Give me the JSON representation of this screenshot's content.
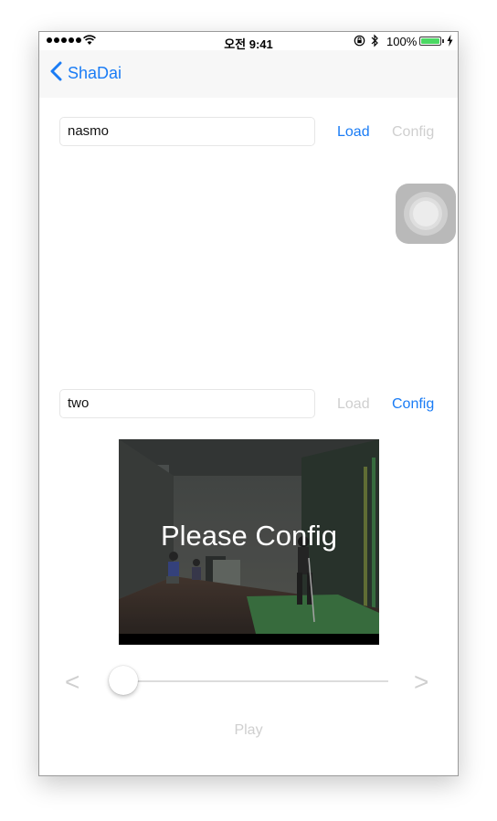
{
  "status_bar": {
    "time": "오전 9:41",
    "battery_percent": "100%",
    "battery_level": 1.0,
    "signal_dots": 5
  },
  "nav": {
    "back_label": "ShaDai"
  },
  "row1": {
    "input_value": "nasmo",
    "load_label": "Load",
    "config_label": "Config"
  },
  "row2": {
    "input_value": "two",
    "load_label": "Load",
    "config_label": "Config"
  },
  "video": {
    "overlay_text": "Please Config"
  },
  "player": {
    "prev_label": "<",
    "next_label": ">",
    "position": 0.0,
    "play_label": "Play"
  },
  "colors": {
    "accent": "#1a7cf5",
    "disabled": "#cfcfcf",
    "battery": "#4cd964"
  }
}
